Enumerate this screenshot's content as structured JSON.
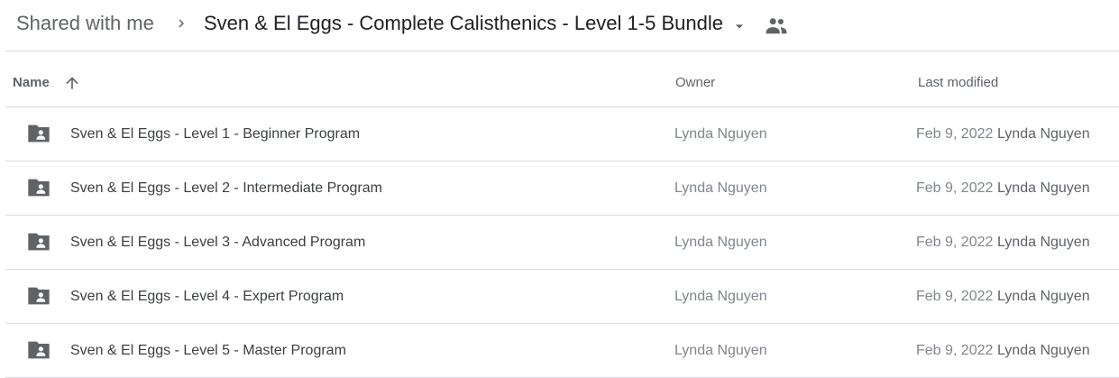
{
  "breadcrumb": {
    "root": "Shared with me",
    "current": "Sven & El Eggs - Complete Calisthenics - Level 1-5 Bundle"
  },
  "columns": {
    "name": "Name",
    "owner": "Owner",
    "last_modified": "Last modified"
  },
  "sort": {
    "column": "Name",
    "direction": "ascending"
  },
  "icons": {
    "separator": "chevron-right-icon",
    "dropdown": "arrow-drop-down-icon",
    "shared": "people-icon",
    "sort": "arrow-upward-icon",
    "row": "shared-folder-icon"
  },
  "colors": {
    "icon": "#5f6368",
    "divider": "#dadce0"
  },
  "files": [
    {
      "name": "Sven & El Eggs - Level 1 - Beginner Program",
      "owner": "Lynda Nguyen",
      "modified_date": "Feb 9, 2022",
      "modified_by": "Lynda Nguyen"
    },
    {
      "name": "Sven & El Eggs - Level 2 - Intermediate Program",
      "owner": "Lynda Nguyen",
      "modified_date": "Feb 9, 2022",
      "modified_by": "Lynda Nguyen"
    },
    {
      "name": "Sven & El Eggs - Level 3 - Advanced Program",
      "owner": "Lynda Nguyen",
      "modified_date": "Feb 9, 2022",
      "modified_by": "Lynda Nguyen"
    },
    {
      "name": "Sven & El Eggs - Level 4 - Expert Program",
      "owner": "Lynda Nguyen",
      "modified_date": "Feb 9, 2022",
      "modified_by": "Lynda Nguyen"
    },
    {
      "name": "Sven & El Eggs - Level 5 - Master Program",
      "owner": "Lynda Nguyen",
      "modified_date": "Feb 9, 2022",
      "modified_by": "Lynda Nguyen"
    }
  ]
}
